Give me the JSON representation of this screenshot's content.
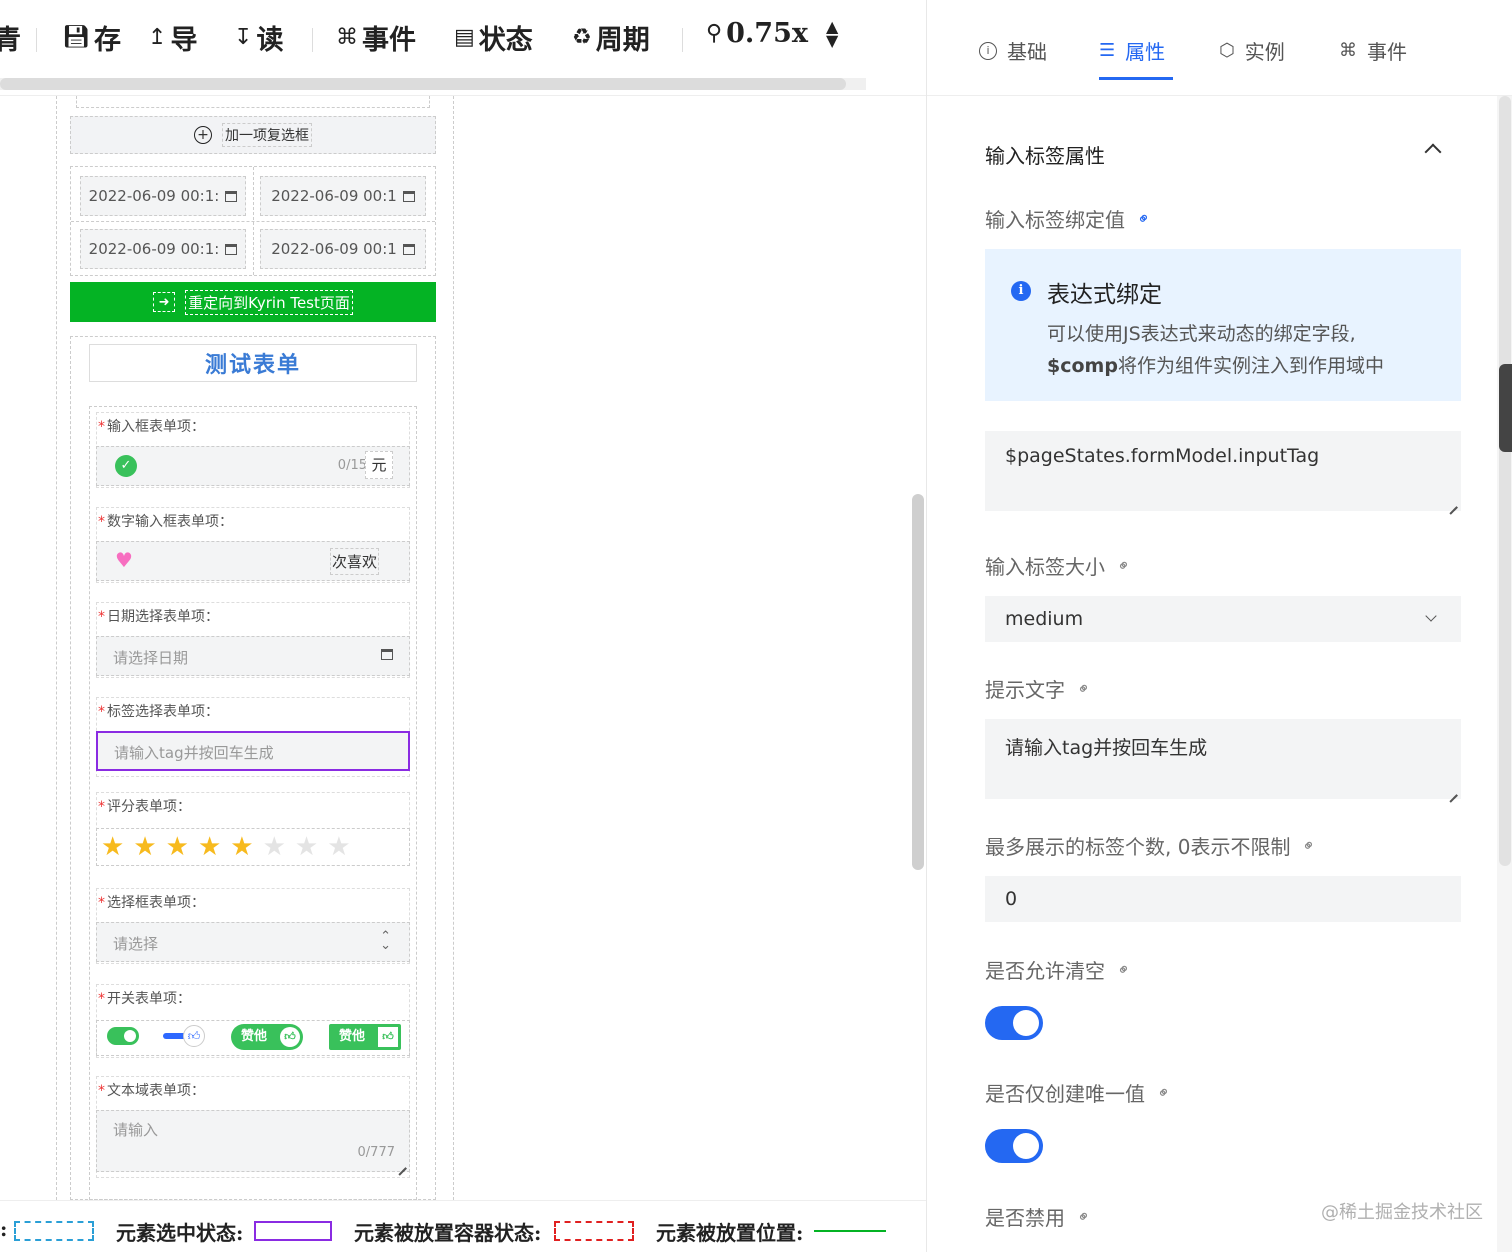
{
  "toolbar": {
    "items": [
      {
        "label": "青",
        "icon": ""
      },
      {
        "label": "存",
        "icon": "save-icon"
      },
      {
        "label": "导",
        "icon": "upload-icon"
      },
      {
        "label": "读",
        "icon": "download-icon"
      },
      {
        "label": "事件",
        "icon": "command-icon"
      },
      {
        "label": "状态",
        "icon": "state-icon"
      },
      {
        "label": "周期",
        "icon": "lifecycle-icon"
      },
      {
        "label": "0.75x",
        "icon": "zoom-icon"
      }
    ]
  },
  "canvas": {
    "add_checkbox": "加一项复选框",
    "dates": [
      "2022-06-09 00:1:",
      "2022-06-09 00:1",
      "2022-06-09 00:1:",
      "2022-06-09 00:1"
    ],
    "redirect_button": "重定向到Kyrin Test页面",
    "form_title": "测试表单",
    "fields": [
      {
        "label": "输入框表单项：",
        "counter": "0/15",
        "suffix": "元"
      },
      {
        "label": "数字输入框表单项：",
        "suffix": "次喜欢"
      },
      {
        "label": "日期选择表单项：",
        "placeholder": "请选择日期"
      },
      {
        "label": "标签选择表单项：",
        "placeholder": "请输入tag并按回车生成"
      },
      {
        "label": "评分表单项：",
        "rating": 5,
        "max": 8
      },
      {
        "label": "选择框表单项：",
        "placeholder": "请选择"
      },
      {
        "label": "开关表单项：",
        "switch_text_1": "赞他",
        "switch_text_2": "赞他"
      },
      {
        "label": "文本域表单项：",
        "placeholder": "请输入",
        "counter": "0/777"
      }
    ]
  },
  "legend": {
    "prefix": ":",
    "selected": "元素选中状态:",
    "container": "元素被放置容器状态:",
    "position": "元素被放置位置:"
  },
  "panel": {
    "tabs": [
      {
        "label": "基础",
        "icon": "info-icon",
        "active": false
      },
      {
        "label": "属性",
        "icon": "list-icon",
        "active": true
      },
      {
        "label": "实例",
        "icon": "cube-icon",
        "active": false
      },
      {
        "label": "事件",
        "icon": "command-icon",
        "active": false
      }
    ],
    "section_title": "输入标签属性",
    "binding_label": "输入标签绑定值",
    "info": {
      "title": "表达式绑定",
      "line1": "可以使用JS表达式来动态的绑定字段,",
      "line2_bold": "$comp",
      "line2_rest": "将作为组件实例注入到作用域中"
    },
    "binding_value": "$pageStates.formModel.inputTag",
    "size_label": "输入标签大小",
    "size_value": "medium",
    "hint_label": "提示文字",
    "hint_value": "请输入tag并按回车生成",
    "max_tags_label": "最多展示的标签个数, 0表示不限制",
    "max_tags_value": "0",
    "clearable_label": "是否允许清空",
    "clearable": true,
    "unique_label": "是否仅创建唯一值",
    "unique": true,
    "disabled_label": "是否禁用"
  },
  "watermark": "@稀土掘金技术社区",
  "colors": {
    "accent": "#2468f2",
    "green": "#04b324",
    "selected_border": "#8a2be2",
    "container_border": "#e02020",
    "hover_border": "#2a9fd6"
  }
}
